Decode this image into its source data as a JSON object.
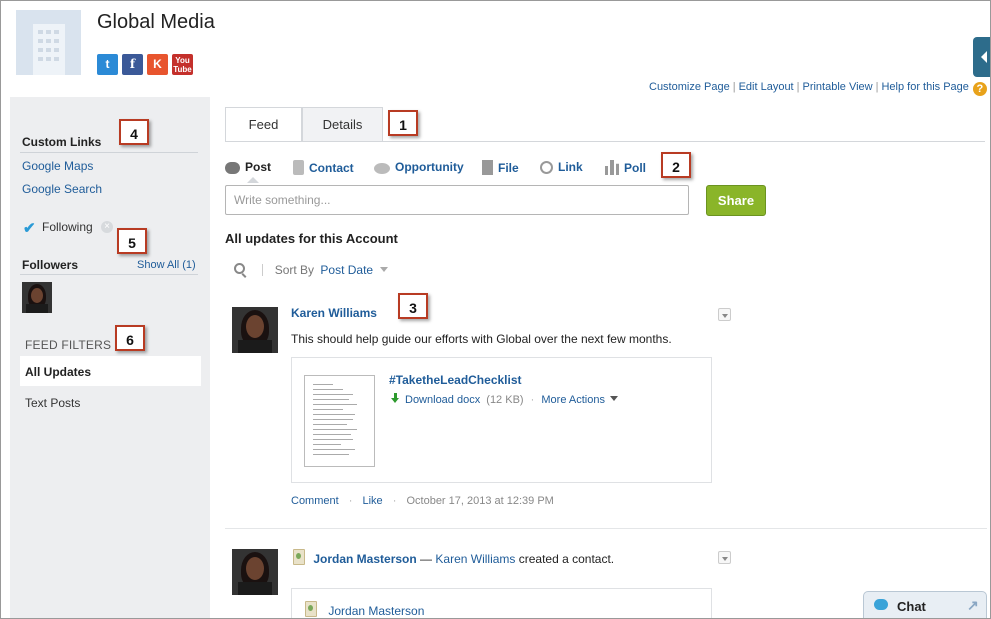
{
  "header": {
    "title": "Global Media",
    "social": [
      {
        "name": "twitter",
        "glyph": "t",
        "color": "#2b8ad6"
      },
      {
        "name": "facebook",
        "glyph": "f",
        "color": "#3b5998"
      },
      {
        "name": "klout",
        "glyph": "K",
        "color": "#e8552e"
      },
      {
        "name": "youtube",
        "glyph": "You",
        "glyph2": "Tube",
        "color": "#c4302b"
      }
    ],
    "links": {
      "customize": "Customize Page",
      "edit_layout": "Edit Layout",
      "printable": "Printable View",
      "help": "Help for this Page",
      "sep": "|",
      "help_icon": "?"
    }
  },
  "left": {
    "custom_links_title": "Custom Links",
    "custom_links": [
      "Google Maps",
      "Google Search"
    ],
    "following_label": "Following",
    "followers_title": "Followers",
    "show_all": "Show All (1)",
    "feed_filters_title": "FEED FILTERS",
    "filters": [
      "All Updates",
      "Text Posts"
    ]
  },
  "tabs": [
    "Feed",
    "Details"
  ],
  "publisher": {
    "actions": [
      "Post",
      "Contact",
      "Opportunity",
      "File",
      "Link",
      "Poll"
    ],
    "placeholder": "Write something...",
    "share_label": "Share"
  },
  "feed": {
    "title": "All updates for this Account",
    "sort_by_label": "Sort By",
    "sort_value": "Post Date",
    "post1": {
      "author": "Karen Williams",
      "text": "This should help guide our efforts with Global over the next few months.",
      "file_title": "#TaketheLeadChecklist",
      "download": "Download docx",
      "size": "(12 KB)",
      "more_actions": "More Actions",
      "comment": "Comment",
      "like": "Like",
      "timestamp": "October 17, 2013 at 12:39 PM",
      "dot": "·"
    },
    "post2": {
      "author": "Jordan Masterson",
      "dash": "—",
      "actor": "Karen Williams",
      "verb": "created a contact.",
      "contact_name": "Jordan Masterson"
    }
  },
  "callouts": [
    "1",
    "2",
    "3",
    "4",
    "5",
    "6"
  ],
  "chat": {
    "label": "Chat"
  }
}
